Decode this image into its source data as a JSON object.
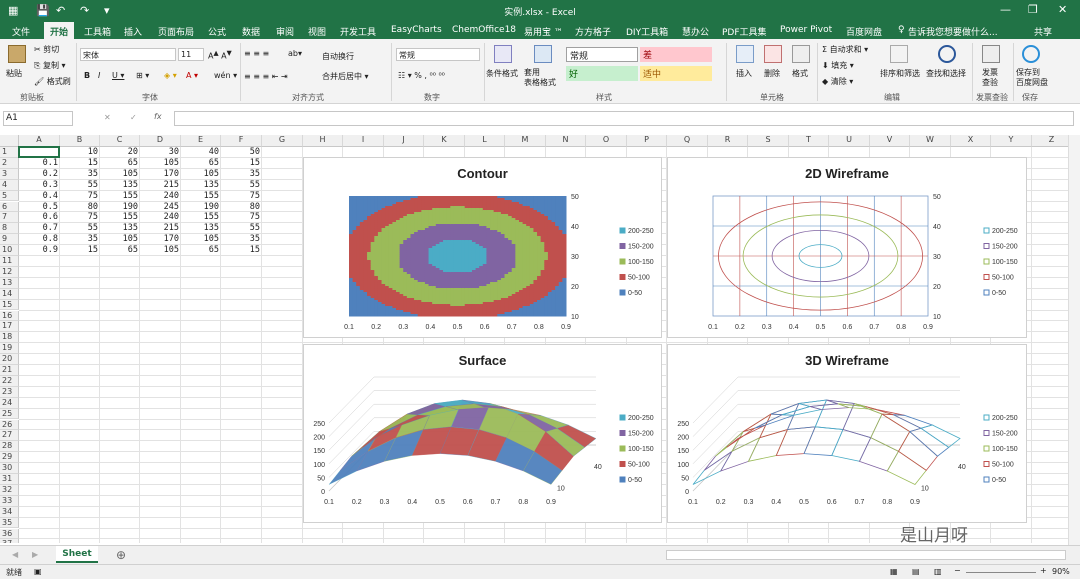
{
  "titlebar": {
    "title": "实例.xlsx - Excel",
    "minimize": "—",
    "restore": "❐",
    "close": "✕"
  },
  "tabs": {
    "file": "文件",
    "home": "开始",
    "toolbox": "工具箱",
    "insert": "插入",
    "layout": "页面布局",
    "formulas": "公式",
    "data": "数据",
    "review": "审阅",
    "view": "视图",
    "dev": "开发工具",
    "easycharts": "EasyCharts",
    "chemoffice": "ChemOffice18",
    "yiyongbao": "易用宝 ™",
    "fangfang": "方方格子",
    "diy": "DIY工具箱",
    "huiban": "慧办公",
    "pdf": "PDF工具集",
    "powerpivot": "Power Pivot",
    "baidu": "百度网盘",
    "tellme": "告诉我您想要做什么...",
    "share": "共享"
  },
  "ribbon": {
    "paste": "粘贴",
    "cut": "剪切",
    "copy": "复制 ▾",
    "format_painter": "格式刷",
    "clipboard": "剪贴板",
    "font_name": "宋体",
    "font_size": "11",
    "font_group": "字体",
    "wrap": "自动换行",
    "merge": "合并后居中 ▾",
    "align_group": "对齐方式",
    "num_format": "常规",
    "number_group": "数字",
    "cond_format": "条件格式",
    "table_format": "套用\n表格格式",
    "style_normal": "常规",
    "style_bad": "差",
    "style_good": "好",
    "style_neutral": "适中",
    "styles_group": "样式",
    "insert": "插入",
    "delete": "删除",
    "format": "格式",
    "cells_group": "单元格",
    "autosum": "自动求和 ▾",
    "fill": "填充 ▾",
    "clear": "清除 ▾",
    "sort": "排序和筛选",
    "find": "查找和选择",
    "edit_group": "编辑",
    "check": "发票\n查验",
    "check_group": "发票查验",
    "save_baidu": "保存到\n百度网盘",
    "save_group": "保存"
  },
  "formula_bar": {
    "name_box": "A1",
    "fx": "fx",
    "value": ""
  },
  "columns": [
    "A",
    "B",
    "C",
    "D",
    "E",
    "F",
    "G",
    "H",
    "I",
    "J",
    "K",
    "L",
    "M",
    "N",
    "O",
    "P",
    "Q",
    "R",
    "S",
    "T",
    "U",
    "V",
    "W",
    "X",
    "Y",
    "Z"
  ],
  "rows": [
    "1",
    "2",
    "3",
    "4",
    "5",
    "6",
    "7",
    "8",
    "9",
    "10",
    "11",
    "12",
    "13",
    "14",
    "15",
    "16",
    "17",
    "18",
    "19",
    "20",
    "21",
    "22",
    "23",
    "24",
    "25",
    "26",
    "27",
    "28",
    "29",
    "30",
    "31",
    "32",
    "33",
    "34",
    "35",
    "36",
    "37"
  ],
  "sheet": [
    [
      "",
      "10",
      "20",
      "30",
      "40",
      "50"
    ],
    [
      "0.1",
      "15",
      "65",
      "105",
      "65",
      "15"
    ],
    [
      "0.2",
      "35",
      "105",
      "170",
      "105",
      "35"
    ],
    [
      "0.3",
      "55",
      "135",
      "215",
      "135",
      "55"
    ],
    [
      "0.4",
      "75",
      "155",
      "240",
      "155",
      "75"
    ],
    [
      "0.5",
      "80",
      "190",
      "245",
      "190",
      "80"
    ],
    [
      "0.6",
      "75",
      "155",
      "240",
      "155",
      "75"
    ],
    [
      "0.7",
      "55",
      "135",
      "215",
      "135",
      "55"
    ],
    [
      "0.8",
      "35",
      "105",
      "170",
      "105",
      "35"
    ],
    [
      "0.9",
      "15",
      "65",
      "105",
      "65",
      "15"
    ]
  ],
  "chart_data": [
    {
      "type": "heatmap",
      "title": "Contour",
      "x": [
        "0.1",
        "0.2",
        "0.3",
        "0.4",
        "0.5",
        "0.6",
        "0.7",
        "0.8",
        "0.9"
      ],
      "y": [
        "10",
        "20",
        "30",
        "40",
        "50"
      ],
      "legend": [
        "200-250",
        "150-200",
        "100-150",
        "50-100",
        "0-50"
      ],
      "legend_position": "right"
    },
    {
      "type": "line",
      "title": "2D Wireframe",
      "x": [
        "0.1",
        "0.2",
        "0.3",
        "0.4",
        "0.5",
        "0.6",
        "0.7",
        "0.8",
        "0.9"
      ],
      "y": [
        "10",
        "20",
        "30",
        "40",
        "50"
      ],
      "legend": [
        "200-250",
        "150-200",
        "100-150",
        "50-100",
        "0-50"
      ],
      "legend_position": "right"
    },
    {
      "type": "area",
      "title": "Surface",
      "x": [
        "0.1",
        "0.2",
        "0.3",
        "0.4",
        "0.5",
        "0.6",
        "0.7",
        "0.8",
        "0.9"
      ],
      "z": [
        "0",
        "50",
        "100",
        "150",
        "200",
        "250"
      ],
      "depth": [
        "10",
        "40"
      ],
      "legend": [
        "200-250",
        "150-200",
        "100-150",
        "50-100",
        "0-50"
      ],
      "legend_position": "right"
    },
    {
      "type": "line",
      "title": "3D Wireframe",
      "x": [
        "0.1",
        "0.2",
        "0.3",
        "0.4",
        "0.5",
        "0.6",
        "0.7",
        "0.8",
        "0.9"
      ],
      "z": [
        "0",
        "50",
        "100",
        "150",
        "200",
        "250"
      ],
      "depth": [
        "10",
        "40"
      ],
      "legend": [
        "200-250",
        "150-200",
        "100-150",
        "50-100",
        "0-50"
      ],
      "legend_position": "right"
    }
  ],
  "legend_colors": [
    "#4bacc6",
    "#8064a2",
    "#9bbb59",
    "#c0504d",
    "#4f81bd"
  ],
  "sheet_tab": "Sheet",
  "status": {
    "ready": "就绪",
    "zoom": "90%"
  },
  "watermark": "是山月呀"
}
